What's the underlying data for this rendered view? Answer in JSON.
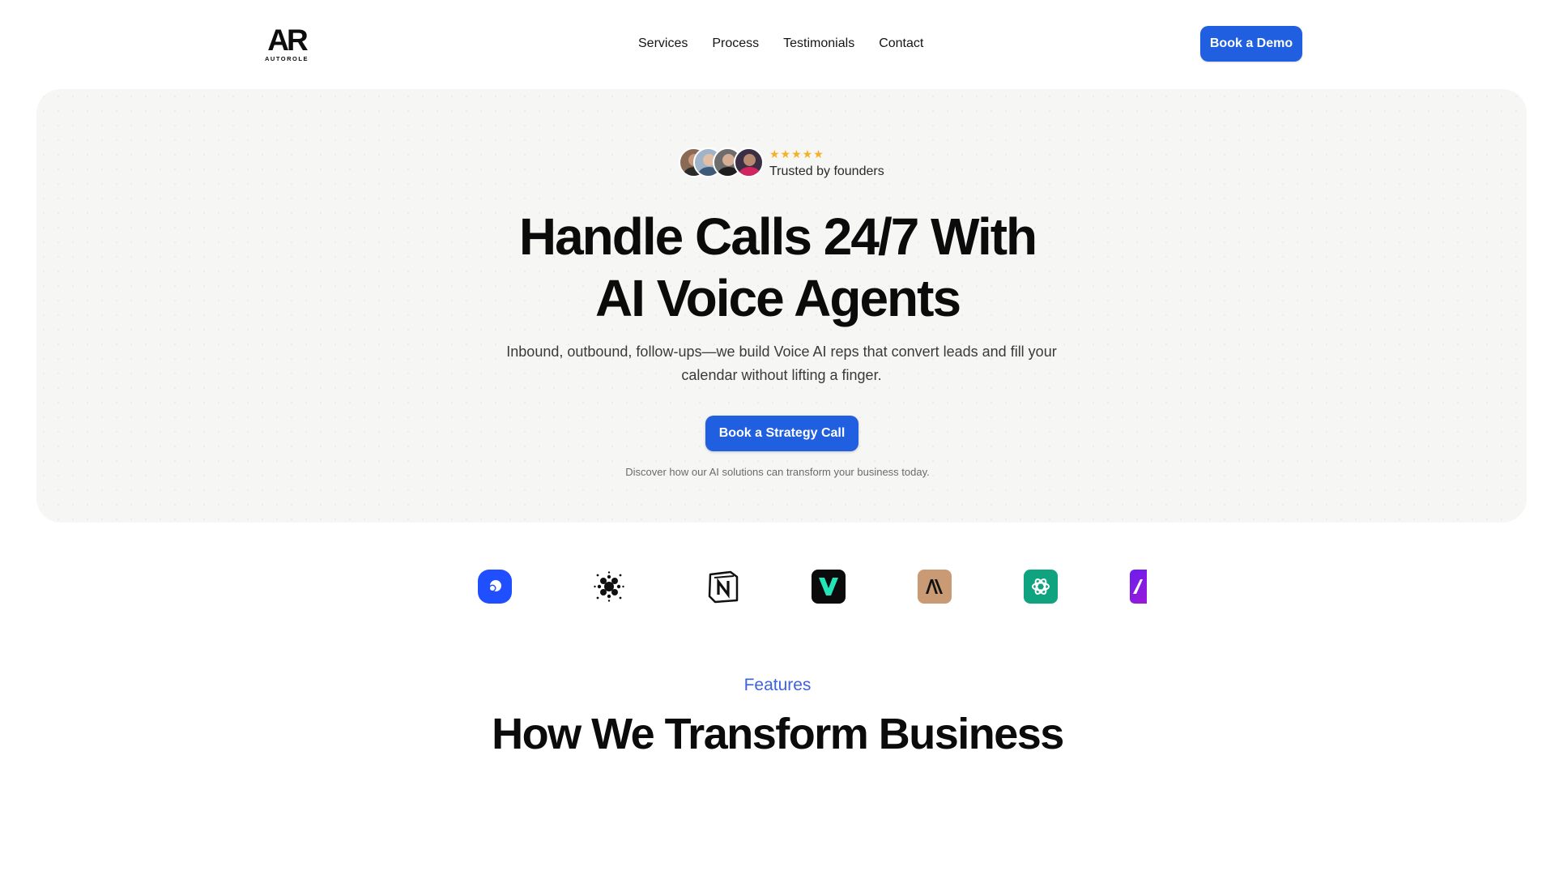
{
  "nav": {
    "logo_mark": "AR",
    "logo_text": "AUTOROLE",
    "links": [
      {
        "label": "Services"
      },
      {
        "label": "Process"
      },
      {
        "label": "Testimonials"
      },
      {
        "label": "Contact"
      }
    ],
    "cta_label": "Book a Demo"
  },
  "hero": {
    "rating_stars": "★★★★★",
    "rating": 5,
    "trusted_label": "Trusted by founders",
    "headline_line1": "Handle Calls 24/7 With",
    "headline_line2": "AI Voice Agents",
    "subtext": "Inbound, outbound, follow-ups—we build Voice AI reps that convert leads and fill your calendar without lifting a finger.",
    "cta_label": "Book a Strategy Call",
    "note": "Discover how our AI solutions can transform your business today."
  },
  "logos": [
    {
      "icon": "blue-chat-logo-icon"
    },
    {
      "icon": "dot-grid-logo-icon"
    },
    {
      "icon": "notion-logo-icon"
    },
    {
      "icon": "vapi-v-logo-icon"
    },
    {
      "icon": "anthropic-logo-icon"
    },
    {
      "icon": "openai-logo-icon"
    },
    {
      "icon": "purple-partial-logo-icon"
    }
  ],
  "features": {
    "label": "Features",
    "title": "How We Transform Business"
  },
  "colors": {
    "accent": "#1f5fe0",
    "features_label": "#3e63dd",
    "hero_bg": "#f6f6f4",
    "star": "#f5b125"
  }
}
